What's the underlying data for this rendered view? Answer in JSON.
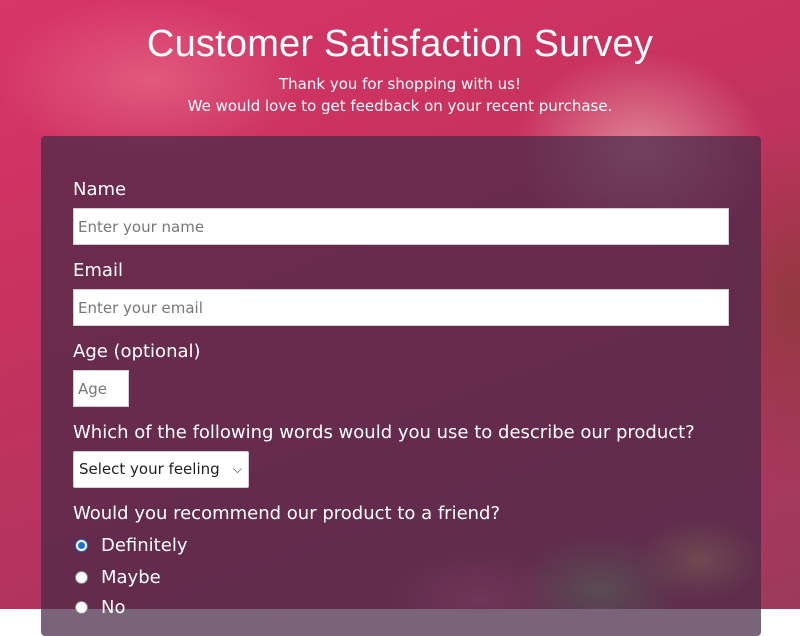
{
  "header": {
    "title": "Customer Satisfaction Survey",
    "subtitle_line1": "Thank you for shopping with us!",
    "subtitle_line2": "We would love to get feedback on your recent purchase."
  },
  "form": {
    "name": {
      "label": "Name",
      "placeholder": "Enter your name",
      "value": ""
    },
    "email": {
      "label": "Email",
      "placeholder": "Enter your email",
      "value": ""
    },
    "age": {
      "label": "Age (optional)",
      "placeholder": "Age",
      "value": ""
    },
    "describe": {
      "label": "Which of the following words would you use to describe our product?",
      "selected": "Select your feeling"
    },
    "recommend": {
      "label": "Would you recommend our product to a friend?",
      "options": [
        {
          "label": "Definitely",
          "checked": true
        },
        {
          "label": "Maybe",
          "checked": false
        },
        {
          "label": "No",
          "checked": false
        }
      ]
    }
  },
  "colors": {
    "background_tint": "#c8325e",
    "card": "#46284699",
    "radio_accent": "#1a6fe0"
  }
}
